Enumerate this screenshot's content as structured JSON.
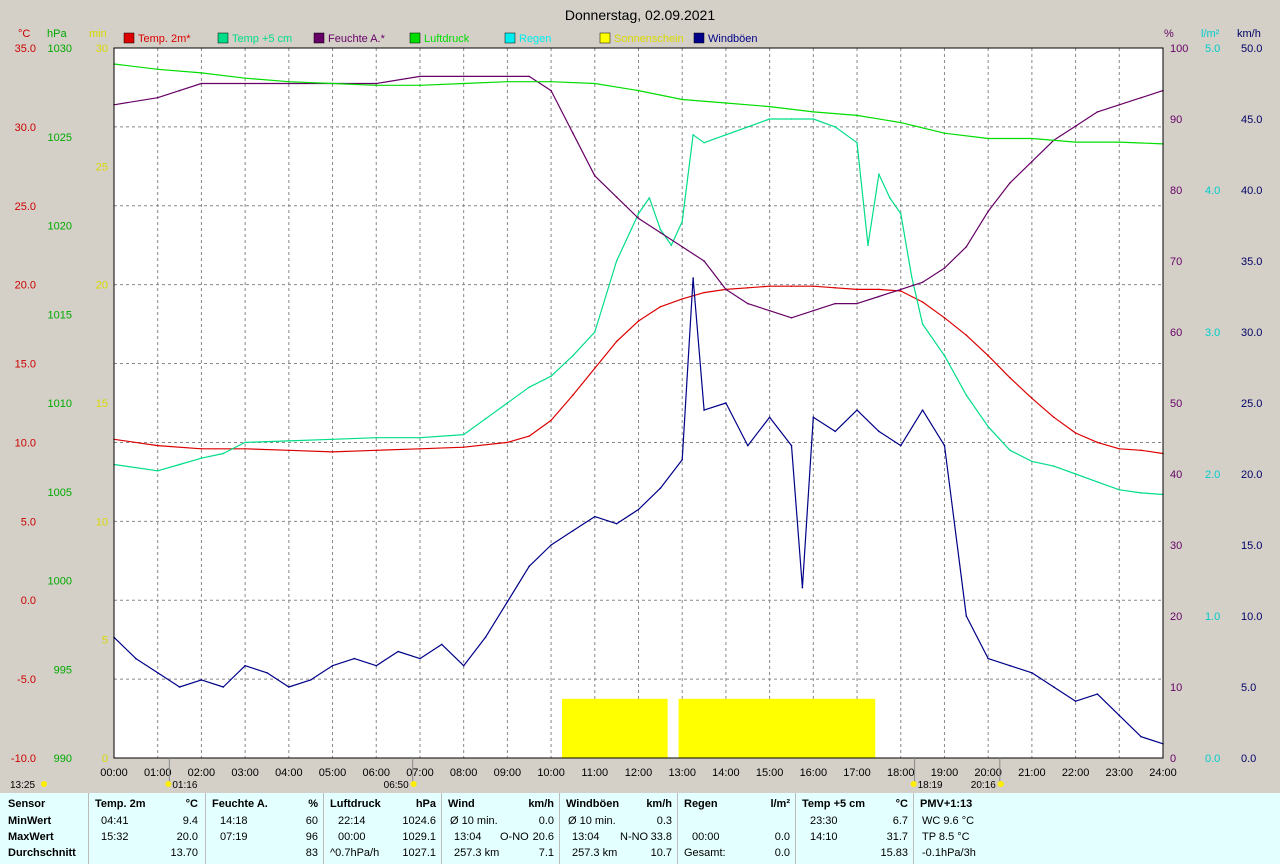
{
  "title": "Donnerstag, 02.09.2021",
  "axes": {
    "temp": {
      "unit": "°C",
      "color": "#cc0000",
      "ticks": [
        "35.0",
        "30.0",
        "25.0",
        "20.0",
        "15.0",
        "10.0",
        "5.0",
        "0.0",
        "-5.0",
        "-10.0"
      ]
    },
    "pressure": {
      "unit": "hPa",
      "color": "#00aa00",
      "ticks": [
        "1030",
        "1025",
        "1020",
        "1015",
        "1010",
        "1005",
        "1000",
        "995",
        "990"
      ]
    },
    "minutes": {
      "unit": "min",
      "color": "#d8d800",
      "ticks": [
        "30",
        "25",
        "20",
        "15",
        "10",
        "5",
        "0"
      ]
    },
    "humidity": {
      "unit": "%",
      "color": "#660066",
      "ticks": [
        "100",
        "90",
        "80",
        "70",
        "60",
        "50",
        "40",
        "30",
        "20",
        "10",
        "0"
      ]
    },
    "rain": {
      "unit": "l/m²",
      "color": "#00cccc",
      "ticks": [
        "5.0",
        "4.0",
        "3.0",
        "2.0",
        "1.0",
        "0.0"
      ]
    },
    "wind": {
      "unit": "km/h",
      "color": "#000066",
      "ticks": [
        "50.0",
        "45.0",
        "40.0",
        "35.0",
        "30.0",
        "25.0",
        "20.0",
        "15.0",
        "10.0",
        "5.0",
        "0.0"
      ]
    }
  },
  "legend": [
    {
      "label": "Temp. 2m*",
      "color": "#dd0000"
    },
    {
      "label": "Temp +5 cm",
      "color": "#00dd88"
    },
    {
      "label": "Feuchte A.*",
      "color": "#660066"
    },
    {
      "label": "Luftdruck",
      "color": "#00dd00"
    },
    {
      "label": "Regen",
      "color": "#00eeee"
    },
    {
      "label": "Sonnenschein",
      "color": "#ffff00"
    },
    {
      "label": "Windböen",
      "color": "#000088"
    }
  ],
  "x_ticks": [
    "00:00",
    "01:00",
    "02:00",
    "03:00",
    "04:00",
    "05:00",
    "06:00",
    "07:00",
    "08:00",
    "09:00",
    "10:00",
    "11:00",
    "12:00",
    "13:00",
    "14:00",
    "15:00",
    "16:00",
    "17:00",
    "18:00",
    "19:00",
    "20:00",
    "21:00",
    "22:00",
    "23:00",
    "24:00"
  ],
  "markers": {
    "moonrise": "01:16",
    "sunrise": "06:50",
    "sunset": "18:19",
    "moonset": "20:16",
    "corner_time": "13:25"
  },
  "chart_data": {
    "type": "line",
    "title": "Donnerstag, 02.09.2021",
    "x_range": [
      "00:00",
      "24:00"
    ],
    "series": [
      {
        "name": "Temp. 2m*",
        "axis": "temp",
        "color": "#dd0000",
        "x": [
          0,
          1,
          2,
          3,
          4,
          5,
          6,
          7,
          8,
          9,
          9.5,
          10,
          10.5,
          11,
          11.5,
          12,
          12.5,
          13,
          13.5,
          14,
          14.5,
          15,
          15.5,
          16,
          16.5,
          17,
          17.5,
          18,
          18.5,
          19,
          19.5,
          20,
          20.5,
          21,
          21.5,
          22,
          22.5,
          23,
          23.5,
          24
        ],
        "y": [
          10.2,
          9.8,
          9.6,
          9.6,
          9.5,
          9.4,
          9.5,
          9.6,
          9.7,
          10.0,
          10.4,
          11.4,
          13.0,
          14.7,
          16.4,
          17.7,
          18.6,
          19.1,
          19.5,
          19.7,
          19.8,
          19.9,
          19.9,
          19.9,
          19.8,
          19.7,
          19.7,
          19.6,
          18.9,
          17.9,
          16.8,
          15.5,
          14.1,
          12.8,
          11.6,
          10.6,
          10.0,
          9.6,
          9.5,
          9.3
        ]
      },
      {
        "name": "Temp +5 cm",
        "axis": "temp",
        "color": "#00dd88",
        "x": [
          0,
          1,
          1.5,
          2,
          2.5,
          3,
          4,
          5,
          6,
          7,
          8,
          8.5,
          9,
          9.5,
          10,
          10.5,
          11,
          11.5,
          12,
          12.25,
          12.5,
          12.75,
          13,
          13.25,
          13.5,
          14,
          14.5,
          15,
          15.5,
          16,
          16.5,
          17,
          17.25,
          17.5,
          17.75,
          18,
          18.25,
          18.5,
          19,
          19.5,
          20,
          20.5,
          21,
          21.5,
          22,
          22.5,
          23,
          23.5,
          24
        ],
        "y": [
          8.6,
          8.2,
          8.6,
          9.0,
          9.3,
          10.0,
          10.1,
          10.2,
          10.3,
          10.3,
          10.5,
          11.5,
          12.5,
          13.5,
          14.2,
          15.5,
          17.0,
          21.5,
          24.5,
          25.5,
          23.5,
          22.5,
          24.0,
          29.5,
          29.0,
          29.5,
          30.0,
          30.5,
          30.5,
          30.5,
          30.0,
          29.0,
          22.5,
          27.0,
          25.5,
          24.5,
          20.5,
          17.5,
          15.5,
          13.0,
          11.0,
          9.5,
          8.8,
          8.5,
          8.0,
          7.5,
          7.0,
          6.8,
          6.7
        ]
      },
      {
        "name": "Feuchte A.*",
        "axis": "humidity",
        "color": "#660066",
        "x": [
          0,
          1,
          1.5,
          2,
          3,
          4,
          5,
          6,
          7,
          8,
          9,
          9.5,
          10,
          10.5,
          11,
          11.5,
          12,
          12.5,
          13,
          13.5,
          14,
          14.5,
          15,
          15.5,
          16,
          16.5,
          17,
          17.5,
          18,
          18.5,
          19,
          19.5,
          20,
          20.5,
          21,
          21.5,
          22,
          22.5,
          23,
          23.5,
          24
        ],
        "y": [
          92,
          93,
          94,
          95,
          95,
          95,
          95,
          95,
          96,
          96,
          96,
          96,
          94,
          88,
          82,
          79,
          76,
          74,
          72,
          70,
          66,
          64,
          63,
          62,
          63,
          64,
          64,
          65,
          66,
          67,
          69,
          72,
          77,
          81,
          84,
          87,
          89,
          91,
          92,
          93,
          94
        ]
      },
      {
        "name": "Luftdruck",
        "axis": "pressure",
        "color": "#00dd00",
        "x": [
          0,
          1,
          2,
          3,
          4,
          5,
          6,
          7,
          8,
          9,
          10,
          11,
          12,
          13,
          14,
          15,
          16,
          17,
          18,
          19,
          20,
          21,
          22,
          23,
          24
        ],
        "y": [
          1029.1,
          1028.8,
          1028.6,
          1028.3,
          1028.1,
          1028.0,
          1027.9,
          1027.9,
          1028.0,
          1028.1,
          1028.1,
          1028.0,
          1027.6,
          1027.1,
          1026.9,
          1026.7,
          1026.4,
          1026.2,
          1025.8,
          1025.2,
          1024.9,
          1024.9,
          1024.7,
          1024.7,
          1024.6
        ]
      },
      {
        "name": "Windböen",
        "axis": "wind",
        "color": "#000088",
        "x": [
          0,
          0.5,
          1,
          1.5,
          2,
          2.5,
          3,
          3.5,
          4,
          4.5,
          5,
          5.5,
          6,
          6.5,
          7,
          7.5,
          8,
          8.5,
          9,
          9.5,
          10,
          10.5,
          11,
          11.5,
          12,
          12.5,
          13,
          13.25,
          13.5,
          14,
          14.5,
          15,
          15.5,
          15.75,
          16,
          16.5,
          17,
          17.5,
          18,
          18.5,
          19,
          19.5,
          20,
          20.5,
          21,
          21.5,
          22,
          22.5,
          23,
          23.5,
          24
        ],
        "y": [
          8.5,
          7.0,
          6.0,
          5.0,
          5.5,
          5.0,
          6.5,
          6.0,
          5.0,
          5.5,
          6.5,
          7.0,
          6.5,
          7.5,
          7.0,
          8.0,
          6.5,
          8.5,
          11.0,
          13.5,
          15.0,
          16.0,
          17.0,
          16.5,
          17.5,
          19.0,
          21.0,
          33.8,
          24.5,
          25.0,
          22.0,
          24.0,
          22.0,
          12.0,
          24.0,
          23.0,
          24.5,
          23.0,
          22.0,
          24.5,
          22.0,
          10.0,
          7.0,
          6.5,
          6.0,
          5.0,
          4.0,
          4.5,
          3.0,
          1.5,
          1.0
        ]
      }
    ],
    "sunshine": {
      "name": "Sonnenschein",
      "axis": "minutes",
      "color": "#ffff00",
      "intervals": [
        [
          "10:15",
          "12:40"
        ],
        [
          "12:55",
          "17:25"
        ]
      ],
      "value": 2.5
    }
  },
  "stats": {
    "columns": [
      {
        "header": "Sensor",
        "unit": ""
      },
      {
        "header": "Temp. 2m",
        "unit": "°C"
      },
      {
        "header": "Feuchte A.",
        "unit": "%"
      },
      {
        "header": "Luftdruck",
        "unit": "hPa"
      },
      {
        "header": "Wind",
        "unit": "km/h"
      },
      {
        "header": "Windböen",
        "unit": "km/h"
      },
      {
        "header": "Regen",
        "unit": "l/m²"
      },
      {
        "header": "Temp +5 cm",
        "unit": "°C"
      },
      {
        "header": "PMV+1:13",
        "unit": ""
      }
    ],
    "row_labels": [
      "MinWert",
      "MaxWert",
      "Durchschnitt"
    ],
    "temp2m": {
      "min_time": "04:41",
      "min": "9.4",
      "max_time": "15:32",
      "max": "20.0",
      "avg": "13.70"
    },
    "humidity": {
      "min_time": "14:18",
      "min": "60",
      "max_time": "07:19",
      "max": "96",
      "avg": "83"
    },
    "pressure": {
      "min_time": "22:14",
      "min": "1024.6",
      "max_time": "00:00",
      "max": "1029.1",
      "trend": "^0.7hPa/h",
      "avg": "1027.1"
    },
    "wind": {
      "r1a": "Ø 10 min.",
      "r1v": "0.0",
      "r2a": "13:04",
      "r2b": "O-NO",
      "r2v": "20.6",
      "r3a": "257.3 km",
      "r3v": "7.1"
    },
    "gusts": {
      "r1a": "Ø 10 min.",
      "r1v": "0.3",
      "r2a": "13:04",
      "r2b": "N-NO",
      "r2v": "33.8",
      "r3a": "257.3 km",
      "r3v": "10.7"
    },
    "rain": {
      "r2a": "00:00",
      "r2v": "0.0",
      "r3a": "Gesamt:",
      "r3v": "0.0"
    },
    "temp5cm": {
      "min_time": "23:30",
      "min": "6.7",
      "max_time": "14:10",
      "max": "31.7",
      "avg": "15.83"
    },
    "pmv": {
      "r1": "WC 9.6 °C",
      "r2": "TP 8.5 °C",
      "r3": "-0.1hPa/3h"
    }
  }
}
